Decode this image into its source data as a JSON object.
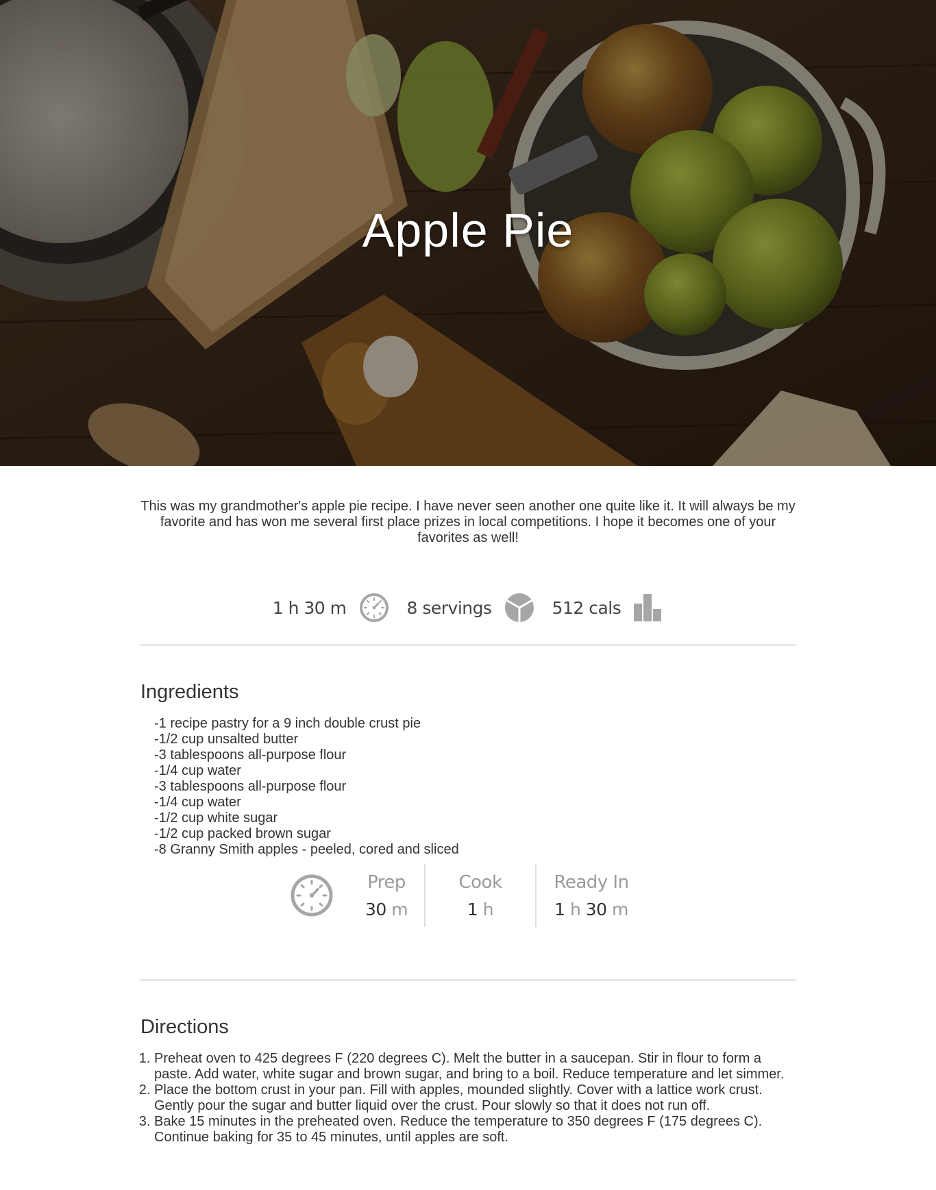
{
  "hero": {
    "title": "Apple Pie"
  },
  "intro": "This was my grandmother's apple pie recipe. I have never seen another one quite like it. It will always be my favorite and has won me several first place prizes in local competitions. I hope it becomes one of your favorites as well!",
  "stats": {
    "time": "1 h 30 m",
    "time_icon": "clock-icon",
    "servings": "8 servings",
    "servings_icon": "pie-icon",
    "calories": "512 cals",
    "calories_icon": "bar-chart-icon"
  },
  "ingredients": {
    "title": "Ingredients",
    "items": [
      "-1 recipe pastry for a 9 inch double crust pie",
      "-1/2 cup unsalted butter",
      "-3 tablespoons all-purpose flour",
      "-1/4 cup water",
      "-3 tablespoons all-purpose flour",
      "-1/4 cup water",
      "-1/2 cup white sugar",
      "-1/2 cup packed brown sugar",
      "-8 Granny Smith apples - peeled, cored and sliced"
    ]
  },
  "times": {
    "icon": "clock-icon",
    "prep": {
      "label": "Prep",
      "num1": "30",
      "unit1": "m"
    },
    "cook": {
      "label": "Cook",
      "num1": "1",
      "unit1": "h"
    },
    "ready": {
      "label": "Ready In",
      "num1": "1",
      "unit1": "h",
      "num2": "30",
      "unit2": "m"
    }
  },
  "directions": {
    "title": "Directions",
    "steps": [
      "Preheat oven to 425 degrees F (220 degrees C). Melt the butter in a saucepan. Stir in flour to form a paste. Add water, white sugar and brown sugar, and bring to a boil. Reduce temperature and let simmer.",
      "Place the bottom crust in your pan. Fill with apples, mounded slightly. Cover with a lattice work crust. Gently pour the sugar and butter liquid over the crust. Pour slowly so that it does not run off.",
      "Bake 15 minutes in the preheated oven. Reduce the temperature to 350 degrees F (175 degrees C). Continue baking for 35 to 45 minutes, until apples are soft."
    ]
  },
  "colors": {
    "icon_gray": "#a6a6a6",
    "text": "#333333",
    "muted": "#9a9a9a"
  }
}
